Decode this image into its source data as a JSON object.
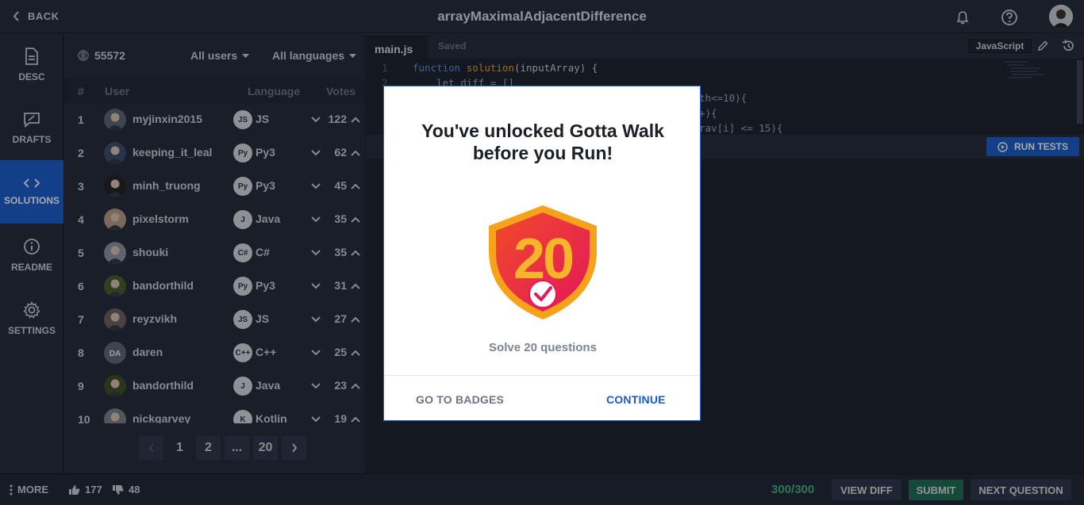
{
  "header": {
    "back_label": "BACK",
    "title": "arrayMaximalAdjacentDifference"
  },
  "nav": [
    {
      "label": "DESC",
      "icon": "document-icon"
    },
    {
      "label": "DRAFTS",
      "icon": "drafts-icon"
    },
    {
      "label": "SOLUTIONS",
      "icon": "code-icon"
    },
    {
      "label": "README",
      "icon": "info-icon"
    },
    {
      "label": "SETTINGS",
      "icon": "gear-icon"
    }
  ],
  "solutions": {
    "count": "55572",
    "filter_users": "All users",
    "filter_languages": "All languages",
    "columns": {
      "num": "#",
      "user": "User",
      "language": "Language",
      "votes": "Votes"
    },
    "rows": [
      {
        "num": "1",
        "user": "myjinxin2015",
        "lang_icon": "JS",
        "language": "JS",
        "votes": "122"
      },
      {
        "num": "2",
        "user": "keeping_it_leal",
        "lang_icon": "Py",
        "language": "Py3",
        "votes": "62"
      },
      {
        "num": "3",
        "user": "minh_truong",
        "lang_icon": "Py",
        "language": "Py3",
        "votes": "45"
      },
      {
        "num": "4",
        "user": "pixelstorm",
        "lang_icon": "J",
        "language": "Java",
        "votes": "35"
      },
      {
        "num": "5",
        "user": "shouki",
        "lang_icon": "C#",
        "language": "C#",
        "votes": "35"
      },
      {
        "num": "6",
        "user": "bandorthild",
        "lang_icon": "Py",
        "language": "Py3",
        "votes": "31"
      },
      {
        "num": "7",
        "user": "reyzvikh",
        "lang_icon": "JS",
        "language": "JS",
        "votes": "27"
      },
      {
        "num": "8",
        "user": "daren",
        "avatar_initials": "DA",
        "lang_icon": "C++",
        "language": "C++",
        "votes": "25"
      },
      {
        "num": "9",
        "user": "bandorthild",
        "lang_icon": "J",
        "language": "Java",
        "votes": "23"
      },
      {
        "num": "10",
        "user": "nickgarvey",
        "lang_icon": "K",
        "language": "Kotlin",
        "votes": "19"
      }
    ],
    "pages": [
      "1",
      "2",
      "...",
      "20"
    ]
  },
  "editor": {
    "tab_main": "main.js",
    "tab_saved": "Saved",
    "language": "JavaScript",
    "run_tests": "RUN TESTS",
    "line_numbers": [
      "1",
      "2"
    ],
    "code_line1": "function solution(inputArray) {",
    "code_line2": "    let diff = []",
    "code_frag3": "th<=10){",
    "code_frag4": "+){",
    "code_frag5": "rav[i] <= 15){"
  },
  "footer": {
    "more": "MORE",
    "likes": "177",
    "dislikes": "48",
    "score": "300/300",
    "view_diff": "VIEW DIFF",
    "submit": "SUBMIT",
    "next_question": "NEXT QUESTION"
  },
  "modal": {
    "title": "You've unlocked Gotta Walk before you Run!",
    "badge_number": "20",
    "description": "Solve 20 questions",
    "go_to_badges": "GO TO BADGES",
    "continue": "CONTINUE"
  },
  "colors": {
    "accent": "#1a5ac8",
    "background": "#1a1f29",
    "panel": "#222937",
    "badge_red": "#e8264d",
    "badge_orange": "#f7a21b",
    "score_green": "#3fb27f"
  }
}
